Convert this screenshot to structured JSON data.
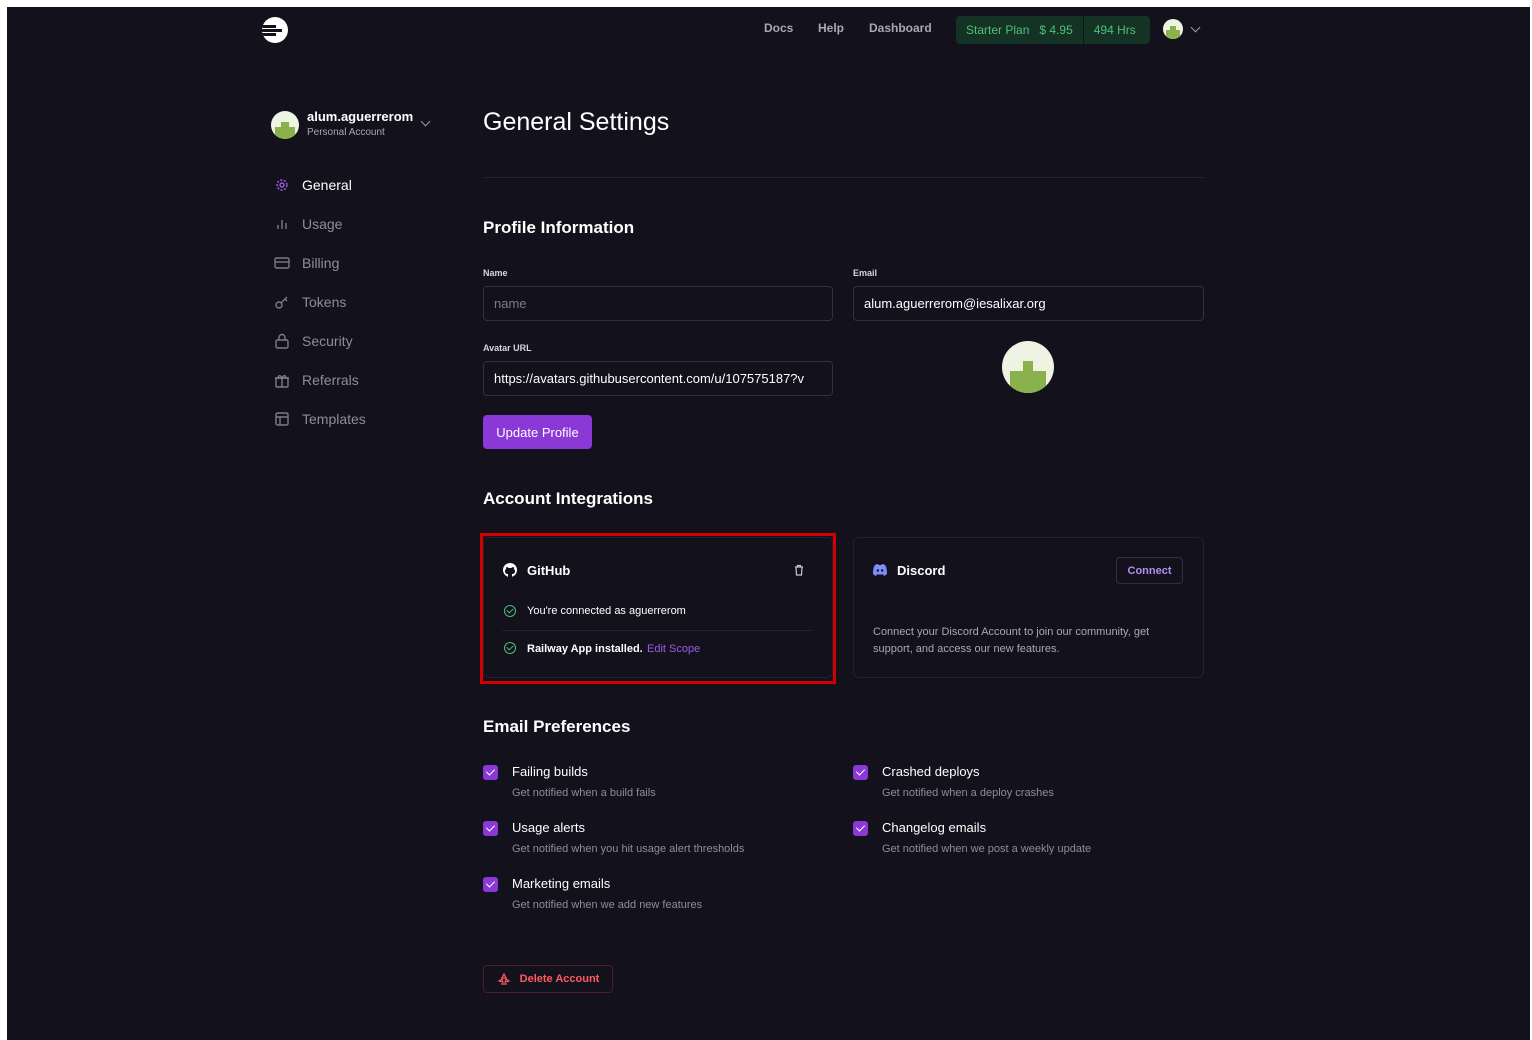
{
  "nav": {
    "links": [
      "Docs",
      "Help",
      "Dashboard"
    ],
    "plan": "Starter Plan",
    "credit": "$ 4.95",
    "hours": "494 Hrs"
  },
  "account": {
    "name": "alum.aguerrerom",
    "type": "Personal Account"
  },
  "sidebar": {
    "items": [
      {
        "label": "General",
        "icon": "gear-icon",
        "active": true
      },
      {
        "label": "Usage",
        "icon": "bar-chart-icon"
      },
      {
        "label": "Billing",
        "icon": "credit-card-icon"
      },
      {
        "label": "Tokens",
        "icon": "key-icon"
      },
      {
        "label": "Security",
        "icon": "lock-icon"
      },
      {
        "label": "Referrals",
        "icon": "gift-icon"
      },
      {
        "label": "Templates",
        "icon": "template-icon"
      }
    ]
  },
  "page": {
    "title": "General Settings"
  },
  "profile": {
    "heading": "Profile Information",
    "name_label": "Name",
    "name_placeholder": "name",
    "email_label": "Email",
    "email_value": "alum.aguerrerom@iesalixar.org",
    "avatar_label": "Avatar URL",
    "avatar_value": "https://avatars.githubusercontent.com/u/107575187?v",
    "update_button": "Update Profile"
  },
  "integrations": {
    "heading": "Account Integrations",
    "github": {
      "title": "GitHub",
      "connected_text": "You're connected as aguerrerom",
      "installed_text": "Railway App installed.",
      "edit_scope": "Edit Scope"
    },
    "discord": {
      "title": "Discord",
      "connect_button": "Connect",
      "description_line1": "Connect your Discord Account to join our community, get",
      "description_line2": "support, and access our new features."
    }
  },
  "email_prefs": {
    "heading": "Email Preferences",
    "items": [
      {
        "title": "Failing builds",
        "desc": "Get notified when a build fails",
        "checked": true
      },
      {
        "title": "Crashed deploys",
        "desc": "Get notified when a deploy crashes",
        "checked": true
      },
      {
        "title": "Usage alerts",
        "desc": "Get notified when you hit usage alert thresholds",
        "checked": true
      },
      {
        "title": "Changelog emails",
        "desc": "Get notified when we post a weekly update",
        "checked": true
      },
      {
        "title": "Marketing emails",
        "desc": "Get notified when we add new features",
        "checked": true
      }
    ]
  },
  "danger": {
    "delete_button": "Delete Account"
  },
  "colors": {
    "background": "#13111c",
    "accent": "#8a38d6",
    "success": "#4fbf79",
    "danger": "#ff5a5f",
    "highlight": "#d40000"
  }
}
